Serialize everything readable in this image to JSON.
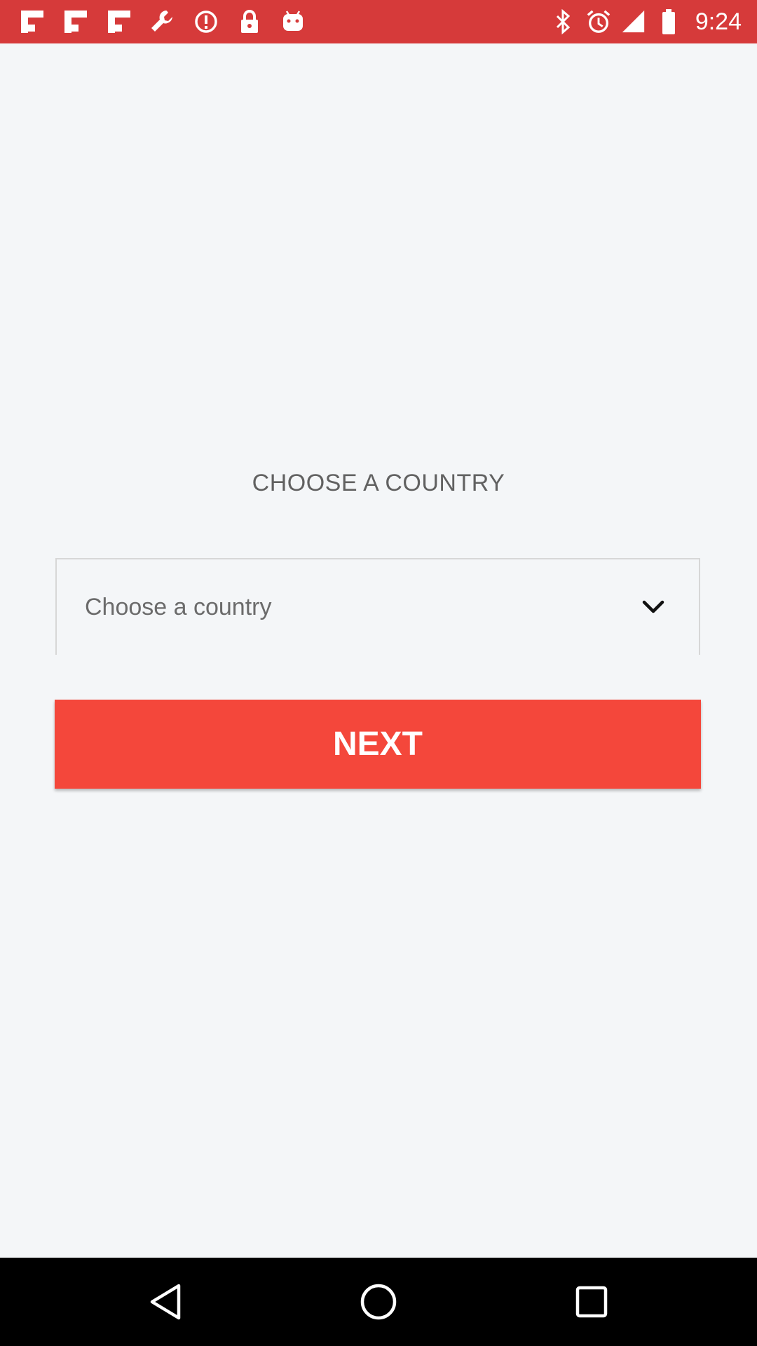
{
  "status_bar": {
    "background": "#d63a3a",
    "left_icons": [
      "flipboard-icon",
      "flipboard-icon",
      "flipboard-icon",
      "wrench-icon",
      "alert-circle-icon",
      "lock-icon",
      "android-icon"
    ],
    "right_icons": [
      "bluetooth-icon",
      "alarm-icon",
      "signal-icon",
      "battery-icon"
    ],
    "time": "9:24"
  },
  "main": {
    "heading": "CHOOSE A COUNTRY",
    "country_select": {
      "value": "Choose a country",
      "icon": "chevron-down-icon"
    },
    "next_button": {
      "label": "NEXT",
      "color": "#f4473b"
    }
  },
  "nav_bar": {
    "buttons": [
      "back-icon",
      "home-icon",
      "recents-icon"
    ]
  }
}
